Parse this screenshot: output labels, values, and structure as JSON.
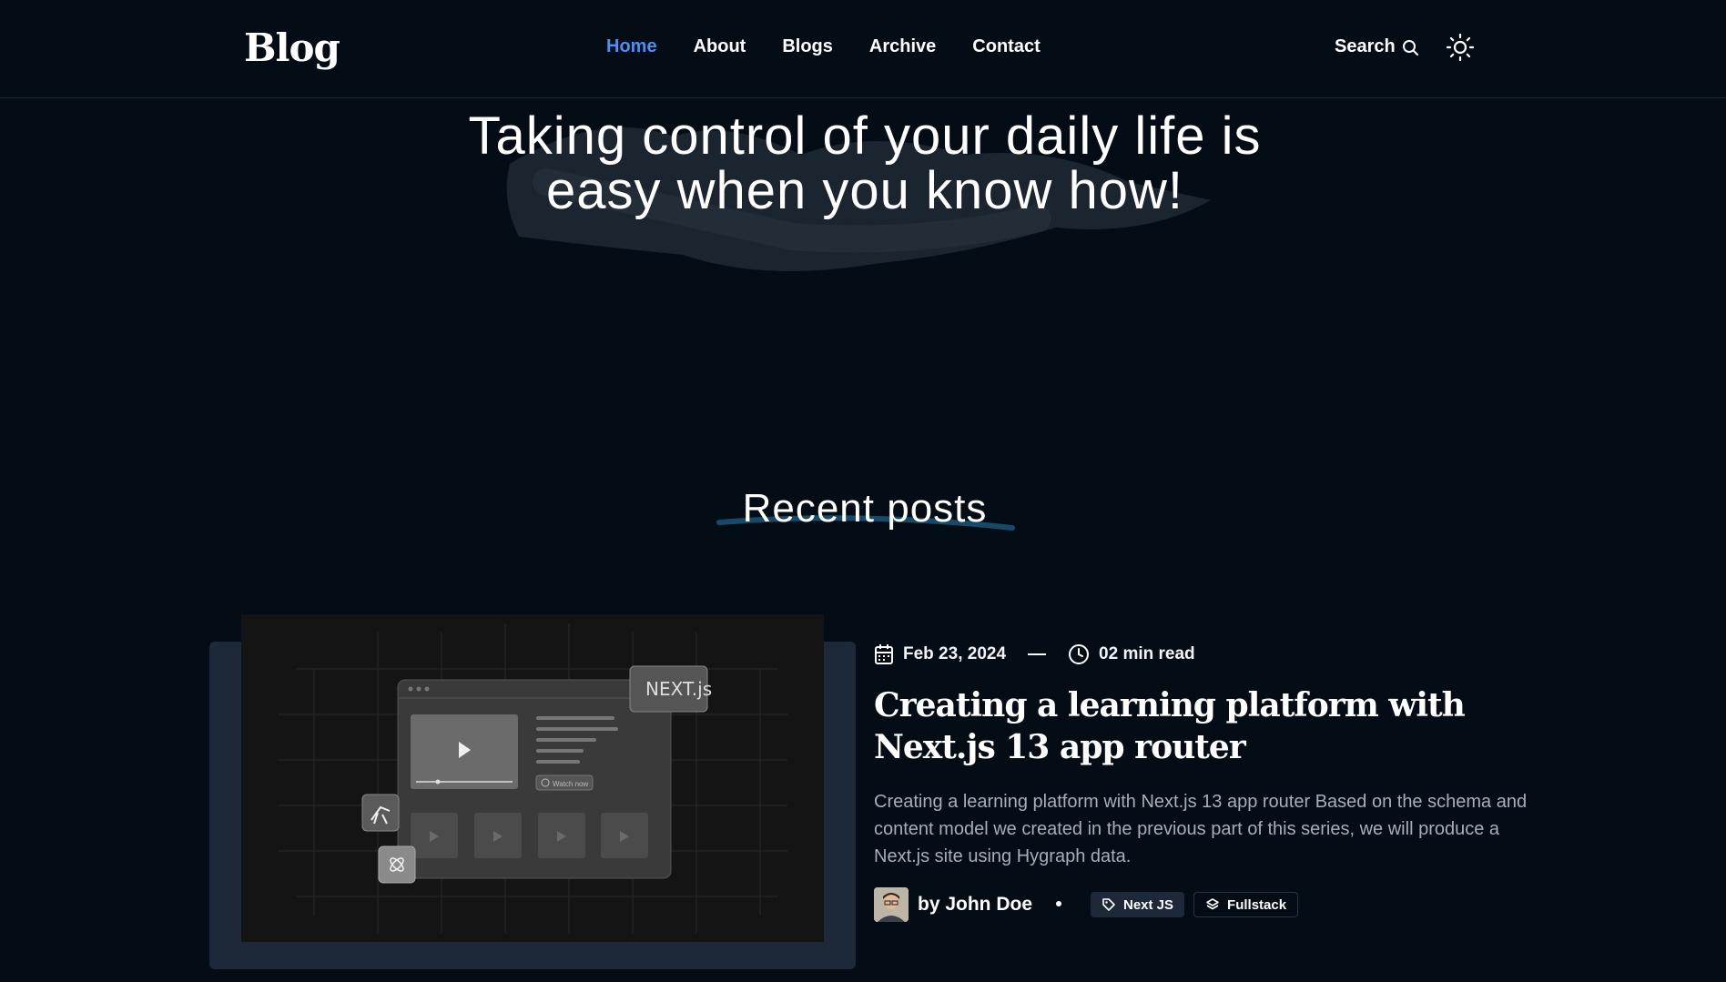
{
  "header": {
    "logo": "Blog",
    "nav": [
      {
        "label": "Home",
        "active": true
      },
      {
        "label": "About",
        "active": false
      },
      {
        "label": "Blogs",
        "active": false
      },
      {
        "label": "Archive",
        "active": false
      },
      {
        "label": "Contact",
        "active": false
      }
    ],
    "search_label": "Search",
    "search_icon": "search-icon",
    "theme_icon": "sun-icon"
  },
  "hero": {
    "title": "Taking control of your daily life is easy when you know how!"
  },
  "recent": {
    "title": "Recent posts"
  },
  "post": {
    "date": "Feb 23, 2024",
    "read_time": "02 min read",
    "title": "Creating a learning platform with Next.js 13 app router",
    "excerpt": "Creating a learning platform with Next.js 13 app router Based on the schema and content model we created in the previous part of this series, we will produce a Next.js site using Hygraph data.",
    "author": "by John Doe",
    "tags": [
      "Next JS",
      "Fullstack"
    ],
    "image": {
      "badge": "NEXT.js",
      "button": "Watch now"
    }
  },
  "colors": {
    "background": "#040d16",
    "accent": "#4f8ef7",
    "card": "#1d2839",
    "muted_text": "#a6adbb"
  }
}
